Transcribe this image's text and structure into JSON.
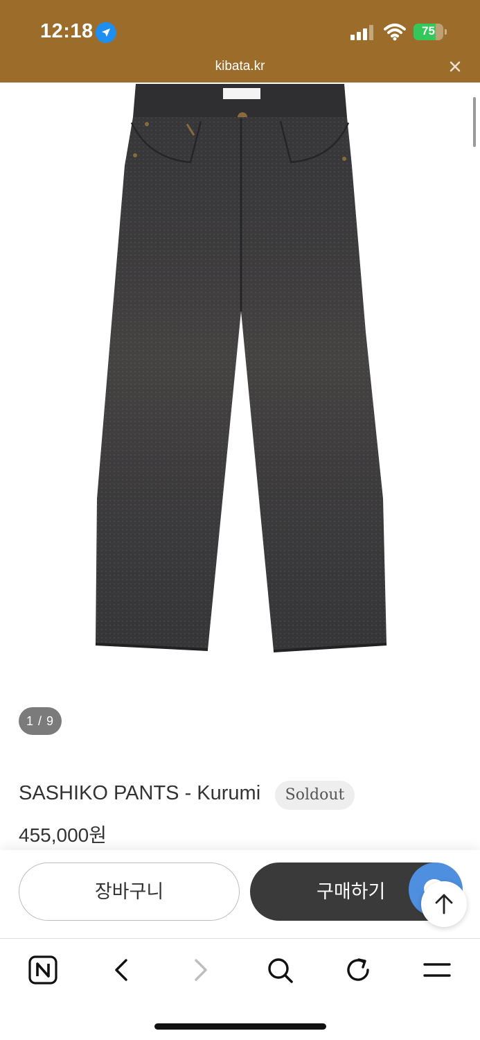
{
  "status_bar": {
    "time": "12:18",
    "battery": "75",
    "battery_level": 0.75,
    "background_color": "#9c6d2a"
  },
  "browser": {
    "url": "kibata.kr"
  },
  "product": {
    "image_counter": "1 / 9",
    "name": "SASHIKO PANTS - Kurumi",
    "status_badge": "Soldout",
    "price": "455,000원"
  },
  "actions": {
    "cart_label": "장바구니",
    "buy_label": "구매하기"
  },
  "toolbar": {
    "items": [
      "naver-icon",
      "back-icon",
      "forward-icon",
      "search-icon",
      "reload-icon",
      "menu-icon"
    ]
  }
}
